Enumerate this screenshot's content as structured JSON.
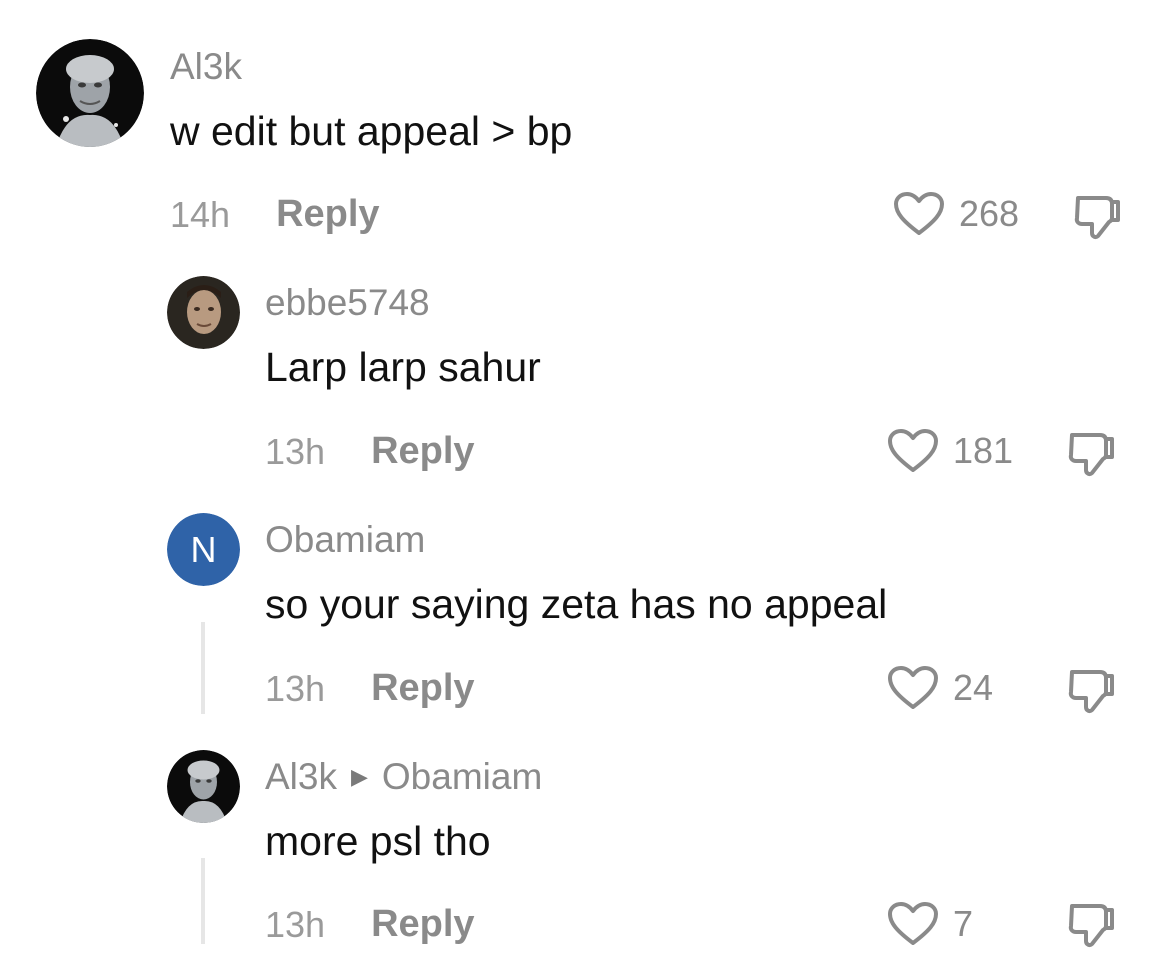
{
  "comments": [
    {
      "username": "Al3k",
      "text": "w edit but appeal > bp",
      "time": "14h",
      "reply_label": "Reply",
      "likes": "268",
      "avatar": "silver-statue-avatar"
    },
    {
      "username": "ebbe5748",
      "text": "Larp larp sahur",
      "time": "13h",
      "reply_label": "Reply",
      "likes": "181",
      "avatar": "face-photo-avatar"
    },
    {
      "username": "Obamiam",
      "text": "so your saying zeta has no appeal",
      "time": "13h",
      "reply_label": "Reply",
      "likes": "24",
      "avatar_letter": "N",
      "avatar_color": "#2f63a8"
    },
    {
      "username": "Al3k",
      "reply_to": "Obamiam",
      "text": "more psl tho",
      "time": "13h",
      "reply_label": "Reply",
      "likes": "7",
      "avatar": "silver-statue-avatar"
    }
  ],
  "colors": {
    "secondary_text": "#8a8a8a",
    "primary_text": "#111111",
    "thread_line": "#e6e6e6"
  }
}
